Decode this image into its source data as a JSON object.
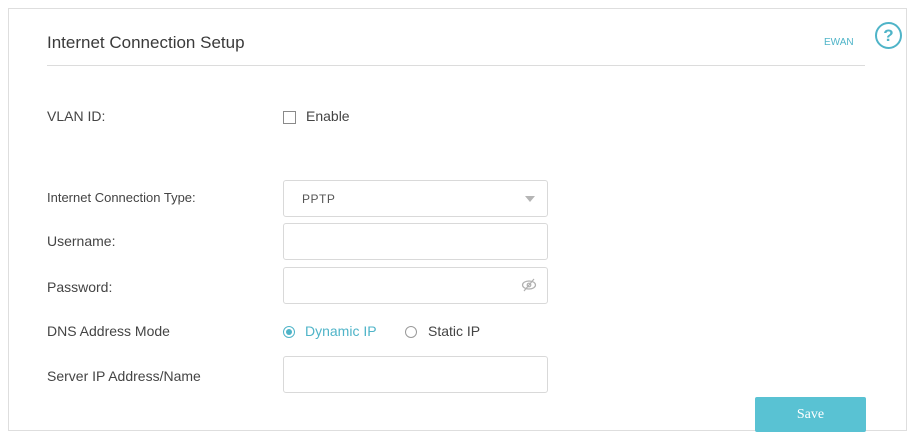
{
  "header": {
    "title": "Internet Connection Setup",
    "ewan_link": "EWAN",
    "help_glyph": "?"
  },
  "vlan": {
    "label": "VLAN ID:",
    "checkbox_label": "Enable",
    "checked": false
  },
  "connection_type": {
    "label": "Internet Connection Type:",
    "value": "PPTP"
  },
  "username": {
    "label": "Username:",
    "value": ""
  },
  "password": {
    "label": "Password:",
    "value": "",
    "visibility_icon": "eye-slash-icon"
  },
  "dns": {
    "label": "DNS Address Mode",
    "options": [
      {
        "label": "Dynamic IP",
        "selected": true
      },
      {
        "label": "Static IP",
        "selected": false
      }
    ]
  },
  "server": {
    "label": "Server IP Address/Name",
    "value": ""
  },
  "actions": {
    "save_label": "Save"
  },
  "colors": {
    "accent": "#4fb4c8",
    "save_button": "#59c2d3"
  }
}
